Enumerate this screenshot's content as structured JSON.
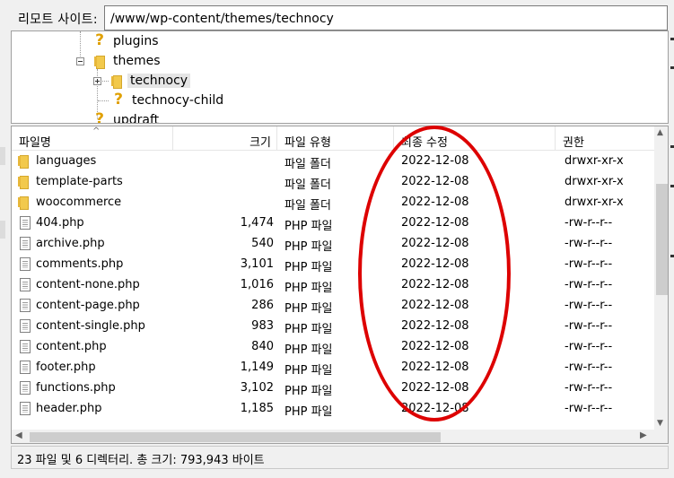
{
  "remote_site": {
    "label": "리모트 사이트:",
    "path": "/www/wp-content/themes/technocy"
  },
  "tree": {
    "items": [
      {
        "name": "plugins",
        "icon": "question-icon"
      },
      {
        "name": "themes",
        "icon": "folder-icon",
        "expanded": true
      },
      {
        "name": "technocy",
        "icon": "folder-icon",
        "selected": true
      },
      {
        "name": "technocy-child",
        "icon": "question-icon"
      },
      {
        "name": "updraft",
        "icon": "question-icon"
      }
    ]
  },
  "columns": {
    "name": "파일명",
    "size": "크기",
    "type": "파일 유형",
    "modified": "최종 수정",
    "permissions": "권한"
  },
  "files": [
    {
      "name": "languages",
      "icon": "folder-icon",
      "size": "",
      "type": "파일 폴더",
      "modified": "2022-12-08",
      "perms": "drwxr-xr-x"
    },
    {
      "name": "template-parts",
      "icon": "folder-icon",
      "size": "",
      "type": "파일 폴더",
      "modified": "2022-12-08",
      "perms": "drwxr-xr-x"
    },
    {
      "name": "woocommerce",
      "icon": "folder-icon",
      "size": "",
      "type": "파일 폴더",
      "modified": "2022-12-08",
      "perms": "drwxr-xr-x"
    },
    {
      "name": "404.php",
      "icon": "file-icon",
      "size": "1,474",
      "type": "PHP 파일",
      "modified": "2022-12-08",
      "perms": "-rw-r--r--"
    },
    {
      "name": "archive.php",
      "icon": "file-icon",
      "size": "540",
      "type": "PHP 파일",
      "modified": "2022-12-08",
      "perms": "-rw-r--r--"
    },
    {
      "name": "comments.php",
      "icon": "file-icon",
      "size": "3,101",
      "type": "PHP 파일",
      "modified": "2022-12-08",
      "perms": "-rw-r--r--"
    },
    {
      "name": "content-none.php",
      "icon": "file-icon",
      "size": "1,016",
      "type": "PHP 파일",
      "modified": "2022-12-08",
      "perms": "-rw-r--r--"
    },
    {
      "name": "content-page.php",
      "icon": "file-icon",
      "size": "286",
      "type": "PHP 파일",
      "modified": "2022-12-08",
      "perms": "-rw-r--r--"
    },
    {
      "name": "content-single.php",
      "icon": "file-icon",
      "size": "983",
      "type": "PHP 파일",
      "modified": "2022-12-08",
      "perms": "-rw-r--r--"
    },
    {
      "name": "content.php",
      "icon": "file-icon",
      "size": "840",
      "type": "PHP 파일",
      "modified": "2022-12-08",
      "perms": "-rw-r--r--"
    },
    {
      "name": "footer.php",
      "icon": "file-icon",
      "size": "1,149",
      "type": "PHP 파일",
      "modified": "2022-12-08",
      "perms": "-rw-r--r--"
    },
    {
      "name": "functions.php",
      "icon": "file-icon",
      "size": "3,102",
      "type": "PHP 파일",
      "modified": "2022-12-08",
      "perms": "-rw-r--r--"
    },
    {
      "name": "header.php",
      "icon": "file-icon",
      "size": "1,185",
      "type": "PHP 파일",
      "modified": "2022-12-08",
      "perms": "-rw-r--r--"
    }
  ],
  "status": "23 파일 및 6 디렉터리. 총 크기: 793,943 바이트",
  "colors": {
    "annotation": "#dd0000",
    "folder": "#f2c94c"
  }
}
